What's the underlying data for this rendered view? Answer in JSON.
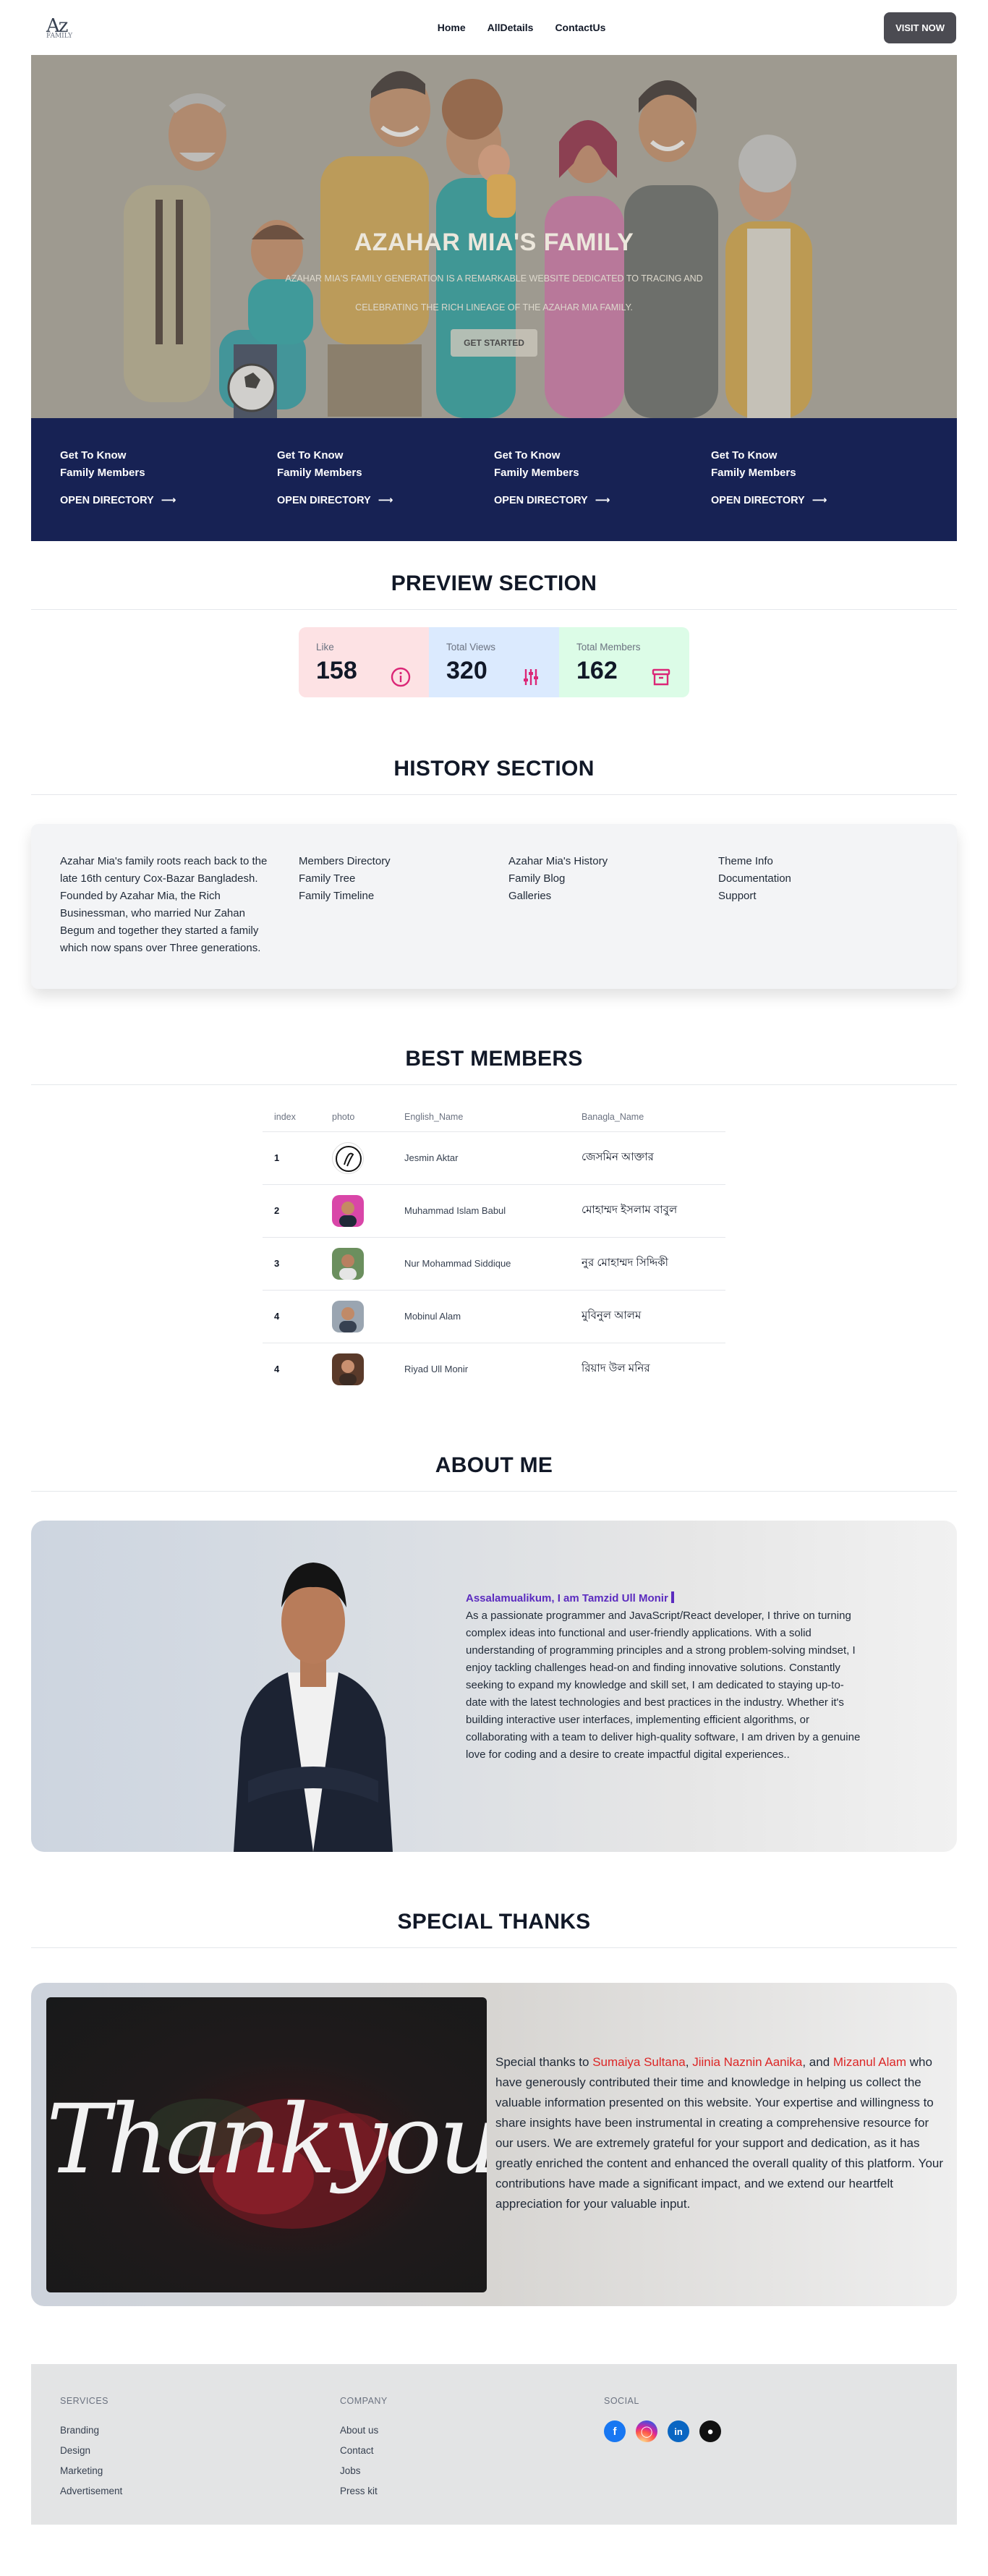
{
  "nav": {
    "logo": "Az",
    "logo_sub": "FAMILY",
    "links": [
      "Home",
      "AllDetails",
      "ContactUs"
    ],
    "visit_label": "VISIT NOW"
  },
  "hero": {
    "title": "AZAHAR MIA'S FAMILY",
    "sub1": "AZAHAR MIA'S FAMILY GENERATION IS A REMARKABLE WEBSITE DEDICATED TO TRACING AND",
    "sub2": "CELEBRATING THE RICH LINEAGE OF THE AZAHAR MIA FAMILY.",
    "button": "GET STARTED"
  },
  "band": {
    "items": [
      {
        "line1": "Get To Know",
        "line2": "Family Members",
        "link": "OPEN DIRECTORY"
      },
      {
        "line1": "Get To Know",
        "line2": "Family Members",
        "link": "OPEN DIRECTORY"
      },
      {
        "line1": "Get To Know",
        "line2": "Family Members",
        "link": "OPEN DIRECTORY"
      },
      {
        "line1": "Get To Know",
        "line2": "Family Members",
        "link": "OPEN DIRECTORY"
      }
    ]
  },
  "preview": {
    "title": "PREVIEW SECTION",
    "stats": [
      {
        "label": "Like",
        "value": "158",
        "bg": "#fde2e4",
        "icon_color": "#db2777",
        "icon": "info-icon"
      },
      {
        "label": "Total Views",
        "value": "320",
        "bg": "#dbeafe",
        "icon_color": "#db2777",
        "icon": "sliders-icon"
      },
      {
        "label": "Total Members",
        "value": "162",
        "bg": "#dcfce7",
        "icon_color": "#db2777",
        "icon": "archive-icon"
      }
    ]
  },
  "history": {
    "title": "HISTORY SECTION",
    "about": "Azahar Mia's family roots reach back to the late 16th century Cox-Bazar Bangladesh. Founded by Azahar Mia, the Rich Businessman, who married Nur Zahan Begum and together they started a family which now spans over Three generations.",
    "col1": [
      "Members Directory",
      "Family Tree",
      "Family Timeline"
    ],
    "col2": [
      "Azahar Mia's History",
      "Family Blog",
      "Galleries"
    ],
    "col3": [
      "Theme Info",
      "Documentation",
      "Support"
    ]
  },
  "members": {
    "title": "BEST MEMBERS",
    "headers": [
      "index",
      "photo",
      "English_Name",
      "Banagla_Name"
    ],
    "rows": [
      {
        "index": "1",
        "english": "Jesmin Aktar",
        "bangla": "জেসমিন আক্তার",
        "photo_bg": "#ffffff"
      },
      {
        "index": "2",
        "english": "Muhammad Islam Babul",
        "bangla": "মোহাম্মদ ইসলাম বাবুল",
        "photo_bg": "#d946a8"
      },
      {
        "index": "3",
        "english": "Nur Mohammad Siddique",
        "bangla": "নুর মোহাম্মদ সিদ্দিকী",
        "photo_bg": "#6b8f5e"
      },
      {
        "index": "4",
        "english": "Mobinul Alam",
        "bangla": "মুবিনুল আলম",
        "photo_bg": "#9aa5b1"
      },
      {
        "index": "4",
        "english": "Riyad Ull Monir",
        "bangla": "রিয়াদ উল মনির",
        "photo_bg": "#5a3a2a"
      }
    ]
  },
  "about": {
    "title": "ABOUT ME",
    "greeting": "Assalamualikum, I am Tamzid Ull Monir",
    "body": "As a passionate programmer and JavaScript/React developer, I thrive on turning complex ideas into functional and user-friendly applications. With a solid understanding of programming principles and a strong problem-solving mindset, I enjoy tackling challenges head-on and finding innovative solutions. Constantly seeking to expand my knowledge and skill set, I am dedicated to staying up-to-date with the latest technologies and best practices in the industry. Whether it's building interactive user interfaces, implementing efficient algorithms, or collaborating with a team to deliver high-quality software, I am driven by a genuine love for coding and a desire to create impactful digital experiences.."
  },
  "thanks": {
    "title": "SPECIAL THANKS",
    "image_text": "Thankyou",
    "intro": "Special thanks to ",
    "name1": "Sumaiya Sultana",
    "sep1": ", ",
    "name2": "Jiinia Naznin Aanika",
    "sep2": ", and ",
    "name3": "Mizanul Alam",
    "body": " who have generously contributed their time and knowledge in helping us collect the valuable information presented on this website. Your expertise and willingness to share insights have been instrumental in creating a comprehensive resource for our users. We are extremely grateful for your support and dedication, as it has greatly enriched the content and enhanced the overall quality of this platform. Your contributions have made a significant impact, and we extend our heartfelt appreciation for your valuable input."
  },
  "footer": {
    "services": {
      "head": "SERVICES",
      "links": [
        "Branding",
        "Design",
        "Marketing",
        "Advertisement"
      ]
    },
    "company": {
      "head": "COMPANY",
      "links": [
        "About us",
        "Contact",
        "Jobs",
        "Press kit"
      ]
    },
    "social": {
      "head": "SOCIAL",
      "icons": [
        "facebook-icon",
        "instagram-icon",
        "linkedin-icon",
        "github-icon"
      ]
    }
  }
}
